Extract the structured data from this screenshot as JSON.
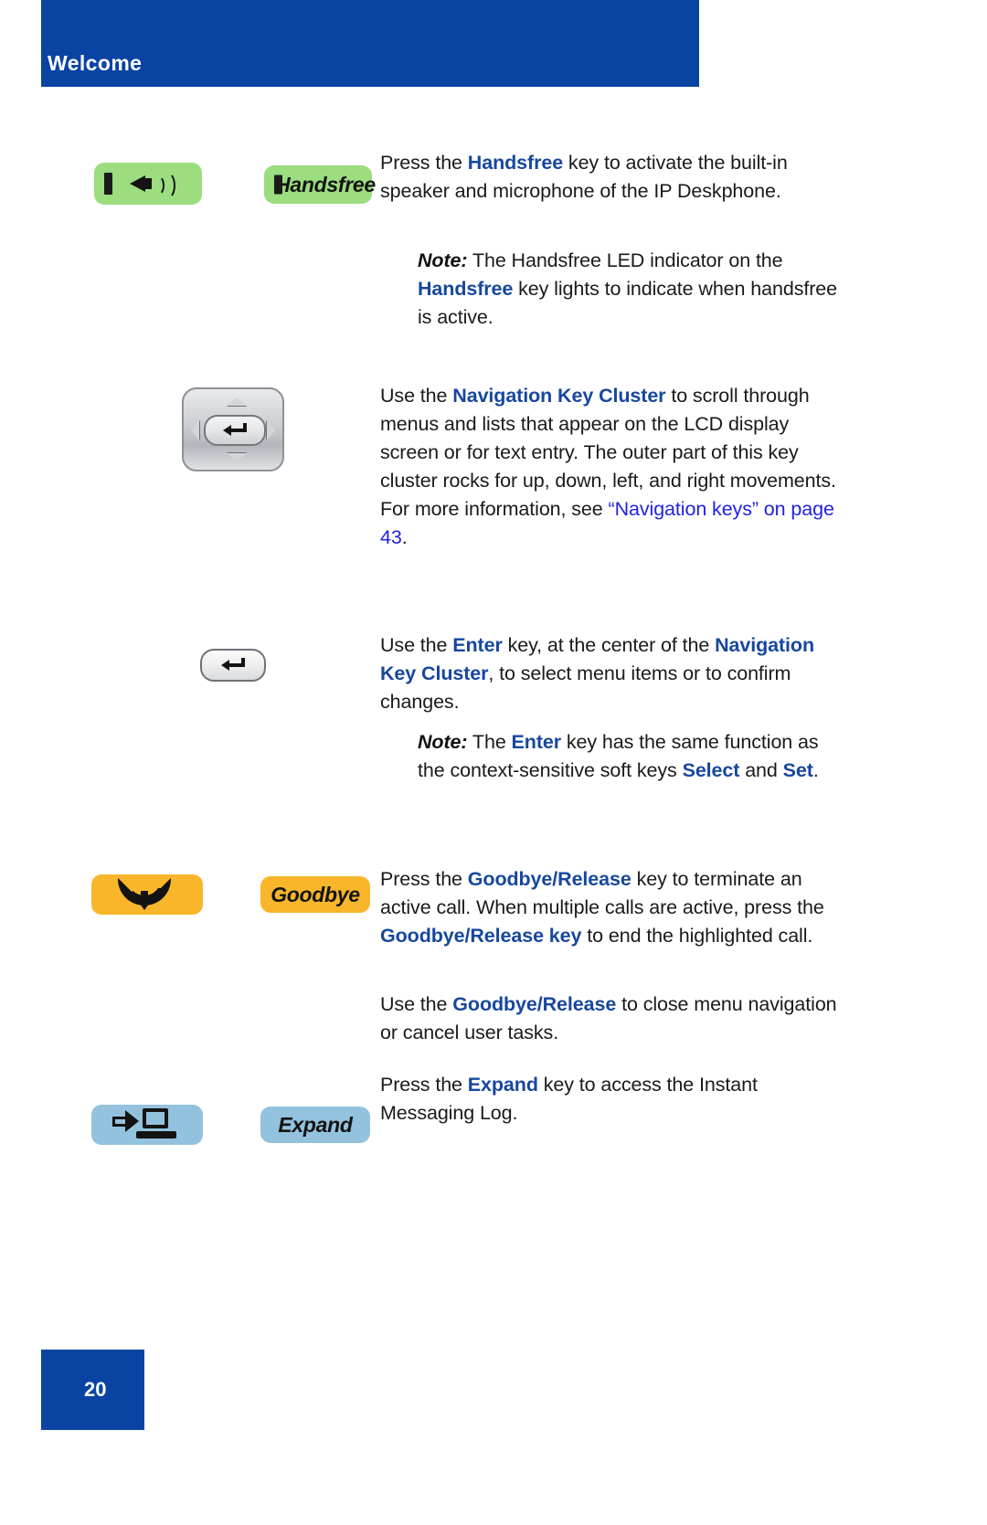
{
  "header": {
    "title": "Welcome",
    "bar_color": "#0a44a3"
  },
  "footer": {
    "page_number": "20",
    "bar_color": "#0a44a3"
  },
  "colors": {
    "key_name_blue": "#17479e",
    "hyperlink_blue": "#2222e0",
    "handsfree_key": "#9bdd7f",
    "goodbye_key": "#f9b62a",
    "expand_key": "#93c2de",
    "navigation_key": "#c9ccd0",
    "body_text": "#1a1a1a"
  },
  "sections": [
    {
      "id": "handsfree",
      "icon_key_label": "Handsfree",
      "paragraph_1": {
        "runs": [
          {
            "text": "Press the ",
            "style": "normal"
          },
          {
            "text": "Handsfree",
            "style": "bold-blue"
          },
          {
            "text": " key to activate the built-in speaker and microphone of the IP Deskphone.",
            "style": "normal"
          }
        ]
      },
      "note": {
        "label": "Note:",
        "runs": [
          {
            "text": "Note:",
            "style": "bold-italic"
          },
          {
            "text": "  The Handsfree LED indicator on the ",
            "style": "normal"
          },
          {
            "text": "Handsfree",
            "style": "bold-blue"
          },
          {
            "text": " key lights to indicate when handsfree is active.",
            "style": "normal"
          }
        ]
      }
    },
    {
      "id": "navigation-key-cluster",
      "paragraph_1": {
        "runs": [
          {
            "text": "Use the ",
            "style": "normal"
          },
          {
            "text": "Navigation Key Cluster",
            "style": "bold-blue"
          },
          {
            "text": " to scroll through menus and lists that appear on the LCD display screen or for text entry. The outer part of this key cluster rocks for up, down, left, and right movements. For more information, see ",
            "style": "normal"
          },
          {
            "text": "“Navigation keys” on page 43",
            "style": "hyperlink"
          },
          {
            "text": ".",
            "style": "normal"
          }
        ]
      }
    },
    {
      "id": "enter-key",
      "paragraph_1": {
        "runs": [
          {
            "text": "Use the ",
            "style": "normal"
          },
          {
            "text": "Enter",
            "style": "bold-blue"
          },
          {
            "text": " key, at the center of the ",
            "style": "normal"
          },
          {
            "text": "Navigation Key Cluster",
            "style": "bold-blue"
          },
          {
            "text": ", to select menu items or to confirm changes.",
            "style": "normal"
          }
        ]
      },
      "note": {
        "label": "Note:",
        "runs": [
          {
            "text": "Note:",
            "style": "bold-italic"
          },
          {
            "text": "  The ",
            "style": "normal"
          },
          {
            "text": "Enter",
            "style": "bold-blue"
          },
          {
            "text": " key has the same function as the context-sensitive soft keys ",
            "style": "normal"
          },
          {
            "text": "Select",
            "style": "bold-blue"
          },
          {
            "text": " and ",
            "style": "normal"
          },
          {
            "text": "Set",
            "style": "bold-blue"
          },
          {
            "text": ".",
            "style": "normal"
          }
        ]
      }
    },
    {
      "id": "goodbye-release",
      "icon_key_label": "Goodbye",
      "paragraph_1": {
        "runs": [
          {
            "text": "Press the ",
            "style": "normal"
          },
          {
            "text": "Goodbye/Release",
            "style": "bold-blue"
          },
          {
            "text": " key to terminate an active call. When multiple calls are active, press the ",
            "style": "normal"
          },
          {
            "text": "Goodbye/Release key",
            "style": "bold-blue"
          },
          {
            "text": " to end the highlighted call.",
            "style": "normal"
          }
        ]
      },
      "paragraph_2": {
        "runs": [
          {
            "text": "Use the ",
            "style": "normal"
          },
          {
            "text": "Goodbye/Release",
            "style": "bold-blue"
          },
          {
            "text": " to close menu navigation or cancel user tasks.",
            "style": "normal"
          }
        ]
      }
    },
    {
      "id": "expand",
      "icon_key_label": "Expand",
      "paragraph_1": {
        "runs": [
          {
            "text": "Press the ",
            "style": "normal"
          },
          {
            "text": "Expand",
            "style": "bold-blue"
          },
          {
            "text": " key to access the Instant Messaging Log.",
            "style": "normal"
          }
        ]
      }
    }
  ],
  "text": {
    "handsfree_para": "",
    "handsfree_note": "",
    "nav_para": "",
    "enter_para": "",
    "enter_note": "",
    "goodbye_para1": "",
    "goodbye_para2": "",
    "expand_para": ""
  }
}
